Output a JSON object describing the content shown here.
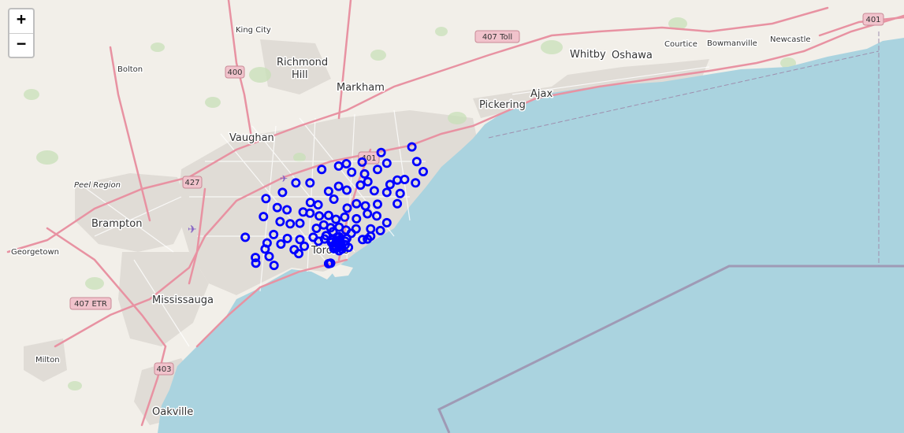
{
  "zoom": {
    "in_label": "+",
    "out_label": "−"
  },
  "colors": {
    "water": "#aad3df",
    "land": "#f2efe9",
    "urban": "#e0dcd6",
    "motorway": "#e892a2",
    "marker": "#0000ff",
    "boundary": "#9e8fae"
  },
  "places": {
    "king_city": "King City",
    "bolton": "Bolton",
    "richmond_hill": "Richmond Hill",
    "markham": "Markham",
    "vaughan": "Vaughan",
    "pickering": "Pickering",
    "ajax": "Ajax",
    "whitby": "Whitby",
    "oshawa": "Oshawa",
    "courtice": "Courtice",
    "bowmanville": "Bowmanville",
    "newcastle": "Newcastle",
    "peel_region": "Peel Region",
    "brampton": "Brampton",
    "georgetown": "Georgetown",
    "mississauga": "Mississauga",
    "milton": "Milton",
    "oakville": "Oakville",
    "toronto": "Toronto"
  },
  "shields": {
    "s407toll": "407 Toll",
    "s400": "400",
    "s401a": "401",
    "s401b": "401",
    "s427": "427",
    "s407etr": "407 ETR",
    "s403": "403"
  },
  "markers": {
    "style": "circle-outline",
    "count": 103,
    "lat_lon": [
      [
        43.816,
        -79.2
      ],
      [
        43.79,
        -79.188
      ],
      [
        43.772,
        -79.172
      ],
      [
        43.752,
        -79.191
      ],
      [
        43.758,
        -79.218
      ],
      [
        43.757,
        -79.236
      ],
      [
        43.787,
        -79.262
      ],
      [
        43.806,
        -79.276
      ],
      [
        43.776,
        -79.285
      ],
      [
        43.749,
        -79.254
      ],
      [
        43.735,
        -79.262
      ],
      [
        43.738,
        -79.293
      ],
      [
        43.768,
        -79.317
      ],
      [
        43.789,
        -79.323
      ],
      [
        43.786,
        -79.362
      ],
      [
        43.782,
        -79.381
      ],
      [
        43.776,
        -79.423
      ],
      [
        43.771,
        -79.349
      ],
      [
        43.754,
        -79.309
      ],
      [
        43.748,
        -79.327
      ],
      [
        43.739,
        -79.361
      ],
      [
        43.746,
        -79.381
      ],
      [
        43.737,
        -79.406
      ],
      [
        43.752,
        -79.452
      ],
      [
        43.752,
        -79.487
      ],
      [
        43.735,
        -79.52
      ],
      [
        43.724,
        -79.561
      ],
      [
        43.708,
        -79.533
      ],
      [
        43.717,
        -79.451
      ],
      [
        43.713,
        -79.432
      ],
      [
        43.723,
        -79.393
      ],
      [
        43.715,
        -79.337
      ],
      [
        43.707,
        -79.36
      ],
      [
        43.711,
        -79.315
      ],
      [
        43.714,
        -79.285
      ],
      [
        43.693,
        -79.287
      ],
      [
        43.697,
        -79.31
      ],
      [
        43.688,
        -79.337
      ],
      [
        43.691,
        -79.366
      ],
      [
        43.687,
        -79.388
      ],
      [
        43.694,
        -79.406
      ],
      [
        43.693,
        -79.429
      ],
      [
        43.698,
        -79.452
      ],
      [
        43.7,
        -79.469
      ],
      [
        43.704,
        -79.509
      ],
      [
        43.692,
        -79.567
      ],
      [
        43.683,
        -79.526
      ],
      [
        43.679,
        -79.501
      ],
      [
        43.68,
        -79.477
      ],
      [
        43.671,
        -79.436
      ],
      [
        43.677,
        -79.418
      ],
      [
        43.672,
        -79.401
      ],
      [
        43.673,
        -79.38
      ],
      [
        43.668,
        -79.363
      ],
      [
        43.67,
        -79.338
      ],
      [
        43.67,
        -79.302
      ],
      [
        43.662,
        -79.35
      ],
      [
        43.665,
        -79.395
      ],
      [
        43.658,
        -79.412
      ],
      [
        43.655,
        -79.444
      ],
      [
        43.651,
        -79.477
      ],
      [
        43.653,
        -79.508
      ],
      [
        43.66,
        -79.542
      ],
      [
        43.645,
        -79.558
      ],
      [
        43.643,
        -79.524
      ],
      [
        43.633,
        -79.491
      ],
      [
        43.639,
        -79.466
      ],
      [
        43.648,
        -79.431
      ],
      [
        43.652,
        -79.416
      ],
      [
        43.65,
        -79.397
      ],
      [
        43.65,
        -79.38
      ],
      [
        43.645,
        -79.388
      ],
      [
        43.641,
        -79.375
      ],
      [
        43.636,
        -79.387
      ],
      [
        43.642,
        -79.365
      ],
      [
        43.653,
        -79.361
      ],
      [
        43.655,
        -79.385
      ],
      [
        43.648,
        -79.365
      ],
      [
        43.64,
        -79.394
      ],
      [
        43.631,
        -79.38
      ],
      [
        43.635,
        -79.393
      ],
      [
        43.634,
        -79.373
      ],
      [
        43.646,
        -79.399
      ],
      [
        43.656,
        -79.38
      ],
      [
        43.647,
        -79.377
      ],
      [
        43.638,
        -79.38
      ],
      [
        43.651,
        -79.322
      ],
      [
        43.652,
        -79.31
      ],
      [
        43.657,
        -79.302
      ],
      [
        43.667,
        -79.278
      ],
      [
        43.681,
        -79.262
      ],
      [
        43.715,
        -79.236
      ],
      [
        43.733,
        -79.229
      ],
      [
        43.655,
        -79.612
      ],
      [
        43.626,
        -79.48
      ],
      [
        43.605,
        -79.541
      ],
      [
        43.609,
        -79.586
      ],
      [
        43.619,
        -79.587
      ],
      [
        43.621,
        -79.553
      ],
      [
        43.634,
        -79.563
      ],
      [
        43.608,
        -79.406
      ],
      [
        43.637,
        -79.357
      ],
      [
        43.609,
        -79.401
      ]
    ]
  }
}
